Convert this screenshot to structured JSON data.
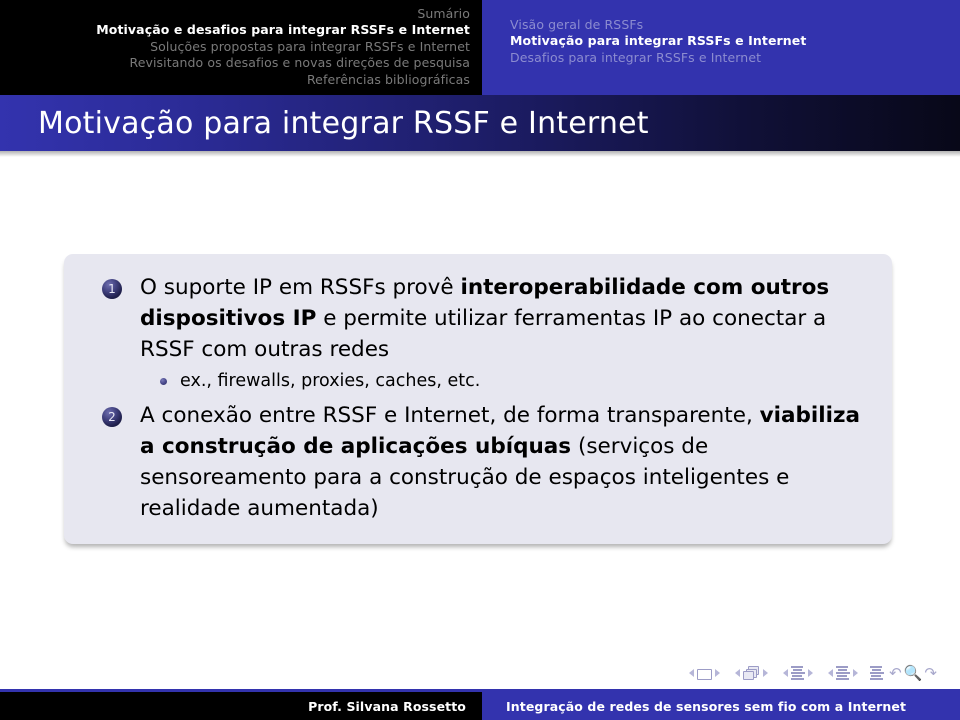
{
  "header": {
    "left_section": {
      "lines": [
        {
          "text": "Sumário",
          "active": false
        },
        {
          "text": "Motivação e desafios para integrar RSSFs e Internet",
          "active": true
        },
        {
          "text": "Soluções propostas para integrar RSSFs e Internet",
          "active": false
        },
        {
          "text": "Revisitando os desafios e novas direções de pesquisa",
          "active": false
        },
        {
          "text": "Referências bibliográficas",
          "active": false
        }
      ]
    },
    "right_section": {
      "lines": [
        {
          "text": "Visão geral de RSSFs",
          "active": false
        },
        {
          "text": "Motivação para integrar RSSFs e Internet",
          "active": true
        },
        {
          "text": "Desafios para integrar RSSFs e Internet",
          "active": false
        }
      ]
    }
  },
  "title": "Motivação para integrar RSSF e Internet",
  "content": {
    "items": [
      {
        "number": "1",
        "text_parts": [
          {
            "text": "O suporte IP em RSSFs provê ",
            "bold": false
          },
          {
            "text": "interoperabilidade com outros dispositivos IP",
            "bold": true
          },
          {
            "text": " e permite utilizar ferramentas IP ao conectar a RSSF com outras redes",
            "bold": false
          }
        ],
        "subitems": [
          {
            "text": "ex., firewalls, proxies, caches, etc."
          }
        ]
      },
      {
        "number": "2",
        "text_parts": [
          {
            "text": "A conexão entre RSSF e Internet, de forma transparente, ",
            "bold": false
          },
          {
            "text": "viabiliza a construção de aplicações ubíquas",
            "bold": true
          },
          {
            "text": " (serviços de sensoreamento para a construção de espaços inteligentes e realidade aumentada)",
            "bold": false
          }
        ],
        "subitems": []
      }
    ]
  },
  "navigation": {
    "groups": [
      {
        "icon": "slide-frame-icon",
        "prev": "◀",
        "next": "▶"
      },
      {
        "icon": "subsection-frames-icon",
        "prev": "◀",
        "next": "▶"
      },
      {
        "icon": "section-lines-icon",
        "prev": "◀",
        "next": "▶"
      },
      {
        "icon": "presentation-lines-icon",
        "prev": "◀",
        "next": "▶"
      }
    ],
    "end_icon": "appendix-lines-icon",
    "back_glyph": "↶",
    "search_glyph": "🔍",
    "forward_glyph": "↷"
  },
  "footer": {
    "author": "Prof. Silvana Rossetto",
    "talk_title": "Integração de redes de sensores sem fio com a Internet"
  },
  "colors": {
    "accent_blue": "#3333ae",
    "black": "#000000",
    "box_background": "#e7e7f0",
    "inactive_text": "#8c8cd0"
  }
}
